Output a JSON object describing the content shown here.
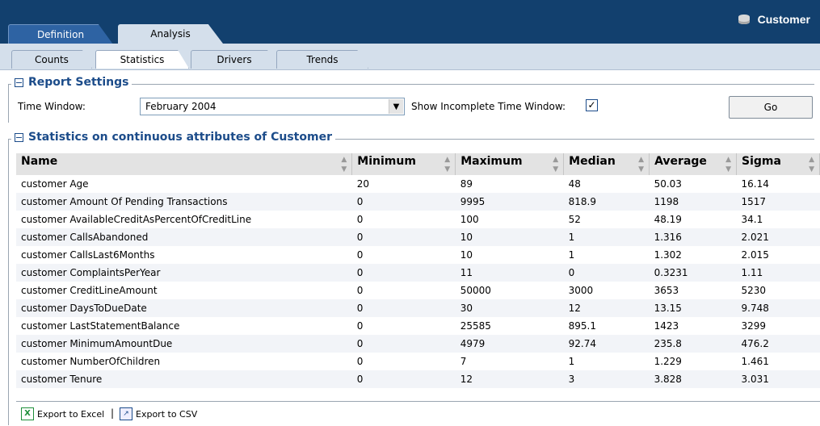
{
  "main_tabs": [
    "Definition",
    "Analysis"
  ],
  "title": "Customer",
  "sub_tabs": [
    "Counts",
    "Statistics",
    "Drivers",
    "Trends"
  ],
  "report_settings": {
    "heading": "Report Settings",
    "time_window_label": "Time Window:",
    "time_window_value": "February 2004",
    "show_incomplete_label": "Show Incomplete Time Window:",
    "go_label": "Go"
  },
  "stats": {
    "heading": "Statistics on continuous attributes of Customer",
    "columns": [
      "Name",
      "Minimum",
      "Maximum",
      "Median",
      "Average",
      "Sigma"
    ],
    "rows": [
      [
        "customer Age",
        "20",
        "89",
        "48",
        "50.03",
        "16.14"
      ],
      [
        "customer Amount Of Pending Transactions",
        "0",
        "9995",
        "818.9",
        "1198",
        "1517"
      ],
      [
        "customer AvailableCreditAsPercentOfCreditLine",
        "0",
        "100",
        "52",
        "48.19",
        "34.1"
      ],
      [
        "customer CallsAbandoned",
        "0",
        "10",
        "1",
        "1.316",
        "2.021"
      ],
      [
        "customer CallsLast6Months",
        "0",
        "10",
        "1",
        "1.302",
        "2.015"
      ],
      [
        "customer ComplaintsPerYear",
        "0",
        "11",
        "0",
        "0.3231",
        "1.11"
      ],
      [
        "customer CreditLineAmount",
        "0",
        "50000",
        "3000",
        "3653",
        "5230"
      ],
      [
        "customer DaysToDueDate",
        "0",
        "30",
        "12",
        "13.15",
        "9.748"
      ],
      [
        "customer LastStatementBalance",
        "0",
        "25585",
        "895.1",
        "1423",
        "3299"
      ],
      [
        "customer MinimumAmountDue",
        "0",
        "4979",
        "92.74",
        "235.8",
        "476.2"
      ],
      [
        "customer NumberOfChildren",
        "0",
        "7",
        "1",
        "1.229",
        "1.461"
      ],
      [
        "customer Tenure",
        "0",
        "12",
        "3",
        "3.828",
        "3.031"
      ]
    ]
  },
  "footer": {
    "export_excel": "Export to Excel",
    "export_csv": "Export to CSV"
  }
}
